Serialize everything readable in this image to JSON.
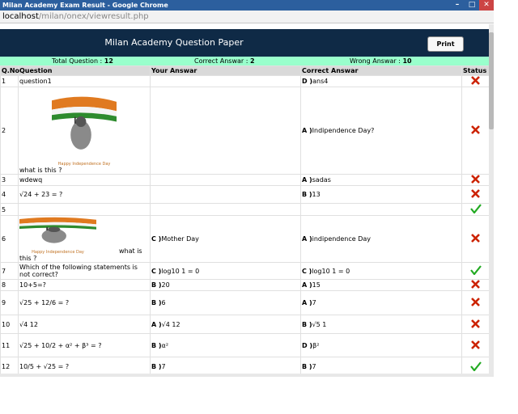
{
  "window": {
    "title": "Milan Academy Exam Result - Google Chrome",
    "url_host": "localhost",
    "url_path": "/milan/onex/viewresult.php"
  },
  "page": {
    "title": "Milan Academy Question Paper",
    "print_label": "Print"
  },
  "summary": {
    "total_label": "Total Question :",
    "total": "12",
    "correct_label": "Correct Answar :",
    "correct": "2",
    "wrong_label": "Wrong Answar :",
    "wrong": "10"
  },
  "columns": {
    "qno": "Q.No",
    "question": "Question",
    "your": "Your Answar",
    "correct": "Correct Answar",
    "status": "Status"
  },
  "rows": [
    {
      "no": "1",
      "question": "question1",
      "your": "",
      "correct_label": "D )",
      "correct": "ans4",
      "status": "wrong"
    },
    {
      "no": "2",
      "question": "what is this ?",
      "image_caption": "Happy Independence Day",
      "your": "",
      "correct_label": "A )",
      "correct": "Indipendence  Day?",
      "status": "wrong"
    },
    {
      "no": "3",
      "question": "wdewq",
      "your": "",
      "correct_label": "A )",
      "correct": "sadas",
      "status": "wrong"
    },
    {
      "no": "4",
      "question": "√24 + 23 = ?",
      "your": "",
      "correct_label": "B )",
      "correct": "13",
      "status": "wrong"
    },
    {
      "no": "5",
      "question": "",
      "your": "",
      "correct_label": "",
      "correct": "",
      "status": "right"
    },
    {
      "no": "6",
      "question_left": "what is",
      "question_rest": "this ?",
      "image_caption": "Happy Independence Day",
      "your_label": "C )",
      "your": "Mother Day",
      "correct_label": "A )",
      "correct": "indipendence Day",
      "status": "wrong"
    },
    {
      "no": "7",
      "question": "Which of the following statements is not correct?",
      "your_label": "C )",
      "your": "log10 1 = 0",
      "correct_label": "C )",
      "correct": "log10 1 = 0",
      "status": "right"
    },
    {
      "no": "8",
      "question": "10+5=?",
      "your_label": "B )",
      "your": "20",
      "correct_label": "A )",
      "correct": "15",
      "status": "wrong"
    },
    {
      "no": "9",
      "question": "√25 + 12/6 = ?",
      "your_label": "B )",
      "your": "6",
      "correct_label": "A )",
      "correct": "7",
      "status": "wrong"
    },
    {
      "no": "10",
      "question": "√4  12",
      "your_label": "A )",
      "your": "√4  12",
      "correct_label": "B )",
      "correct": "√5 1",
      "status": "wrong"
    },
    {
      "no": "11",
      "question": "√25 + 10/2 + α² + β³ = ?",
      "your_label": "B )",
      "your": "α²",
      "correct_label": "D )",
      "correct": "β²",
      "status": "wrong"
    },
    {
      "no": "12",
      "question": "10/5 + √25 = ?",
      "your_label": "B )",
      "your": "7",
      "correct_label": "B )",
      "correct": "7",
      "status": "right"
    }
  ],
  "colors": {
    "header_bg": "#0f2a46",
    "summary_bg": "#99ffcc",
    "wrong": "#cc2200",
    "right": "#22aa22"
  }
}
